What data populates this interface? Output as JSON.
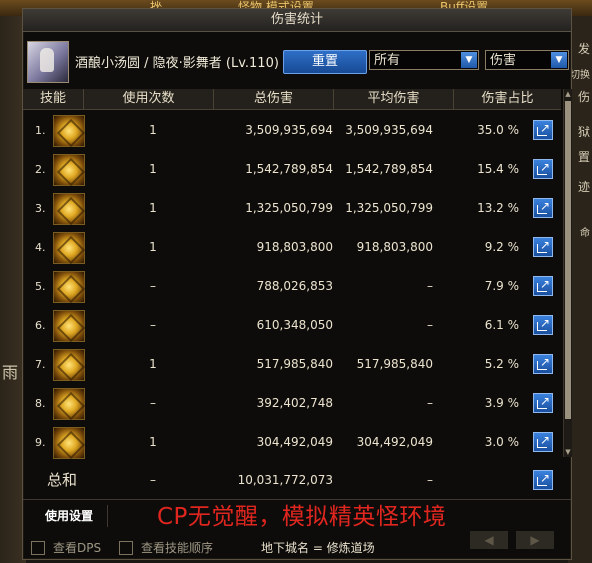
{
  "background": {
    "top_left": "挫",
    "top_mid": "怪物,模式设置",
    "top_right": "Buff设置",
    "right_texts": [
      "发",
      "切换",
      "伤",
      "狱",
      "置",
      "迹",
      "命"
    ],
    "left_texts": [
      "雨"
    ]
  },
  "window": {
    "title": "伤害统计"
  },
  "header": {
    "character": "酒酿小汤圆 / 隐夜·影舞者 (Lv.110)",
    "reset_label": "重置",
    "filter_value": "所有",
    "metric_value": "伤害"
  },
  "table": {
    "columns": [
      "技能",
      "使用次数",
      "总伤害",
      "平均伤害",
      "伤害占比"
    ],
    "rows": [
      {
        "index": "1.",
        "uses": "1",
        "total": "3,509,935,694",
        "avg": "3,509,935,694",
        "pct": "35.0 %"
      },
      {
        "index": "2.",
        "uses": "1",
        "total": "1,542,789,854",
        "avg": "1,542,789,854",
        "pct": "15.4 %"
      },
      {
        "index": "3.",
        "uses": "1",
        "total": "1,325,050,799",
        "avg": "1,325,050,799",
        "pct": "13.2 %"
      },
      {
        "index": "4.",
        "uses": "1",
        "total": "918,803,800",
        "avg": "918,803,800",
        "pct": "9.2 %"
      },
      {
        "index": "5.",
        "uses": "–",
        "total": "788,026,853",
        "avg": "–",
        "pct": "7.9 %"
      },
      {
        "index": "6.",
        "uses": "–",
        "total": "610,348,050",
        "avg": "–",
        "pct": "6.1 %"
      },
      {
        "index": "7.",
        "uses": "1",
        "total": "517,985,840",
        "avg": "517,985,840",
        "pct": "5.2 %"
      },
      {
        "index": "8.",
        "uses": "–",
        "total": "392,402,748",
        "avg": "–",
        "pct": "3.9 %"
      },
      {
        "index": "9.",
        "uses": "1",
        "total": "304,492,049",
        "avg": "304,492,049",
        "pct": "3.0 %"
      }
    ],
    "sum": {
      "label": "总和",
      "uses": "–",
      "total": "10,031,772,073",
      "avg": "–"
    }
  },
  "footer": {
    "usage_settings": "使用设置",
    "annotation": "CP无觉醒，模拟精英怪环境",
    "check_dps": "查看DPS",
    "check_skill_order": "查看技能顺序",
    "dungeon": "地下城名 = 修炼道场"
  },
  "colors": {
    "accent_blue": "#2f6fc7",
    "annotation_red": "#e0261f",
    "skill_gold": "#e0a923"
  }
}
